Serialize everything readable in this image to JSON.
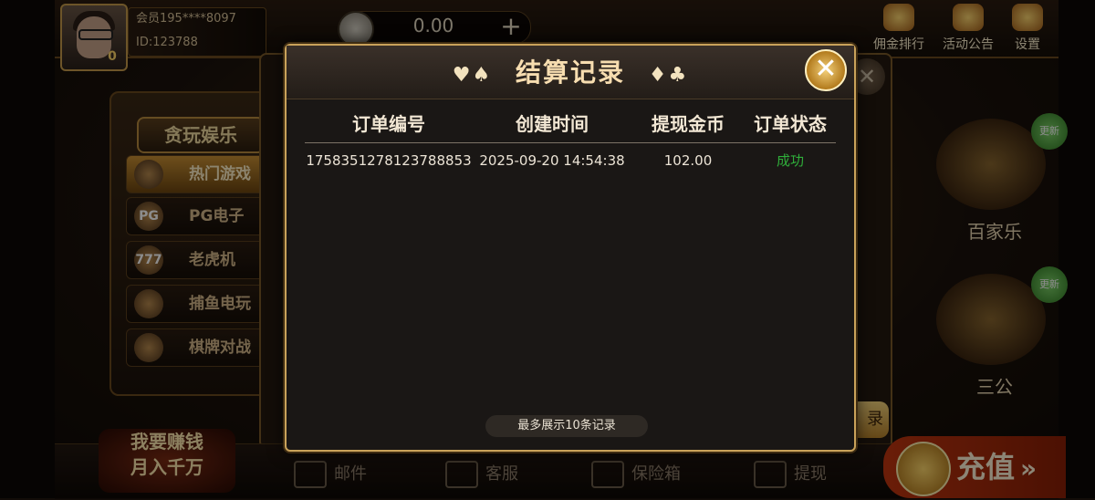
{
  "user": {
    "member": "会员195****8097",
    "id": "ID:123788",
    "vip_level": "0"
  },
  "balance": "0.00",
  "top_actions": [
    {
      "label": "佣金排行",
      "icon": "trophy-icon"
    },
    {
      "label": "活动公告",
      "icon": "gift-icon"
    },
    {
      "label": "设置",
      "icon": "gear-icon"
    }
  ],
  "left_menu": {
    "title": "贪玩娱乐",
    "items": [
      {
        "label": "热门游戏",
        "icon_text": "",
        "active": true
      },
      {
        "label": "PG电子",
        "icon_text": "PG"
      },
      {
        "label": "老虎机",
        "icon_text": "777"
      },
      {
        "label": "捕鱼电玩",
        "icon_text": ""
      },
      {
        "label": "棋牌对战",
        "icon_text": ""
      }
    ]
  },
  "game_tiles": [
    {
      "label": "百家乐",
      "badge": "更新"
    },
    {
      "label": "三公",
      "badge": "更新"
    }
  ],
  "mid_panel_button": "录",
  "modal": {
    "title": "结算记录",
    "title_suits_left": "♥♠",
    "title_suits_right": "♦♣",
    "close_glyph": "✕",
    "columns": [
      "订单编号",
      "创建时间",
      "提现金币",
      "订单状态"
    ],
    "rows": [
      {
        "order_id": "1758351278123788853",
        "created": "2025-09-20 14:54:38",
        "amount": "102.00",
        "status": "成功"
      }
    ],
    "footer_note": "最多展示10条记录"
  },
  "bottom_nav": [
    {
      "label": "邮件",
      "icon": "mail-icon"
    },
    {
      "label": "客服",
      "icon": "phone-icon"
    },
    {
      "label": "保险箱",
      "icon": "safe-icon"
    },
    {
      "label": "提现",
      "icon": "wallet-icon"
    }
  ],
  "promo": {
    "line1": "我要赚钱",
    "line2": "月入千万"
  },
  "recharge": {
    "label": "充值",
    "arrows": "»"
  }
}
